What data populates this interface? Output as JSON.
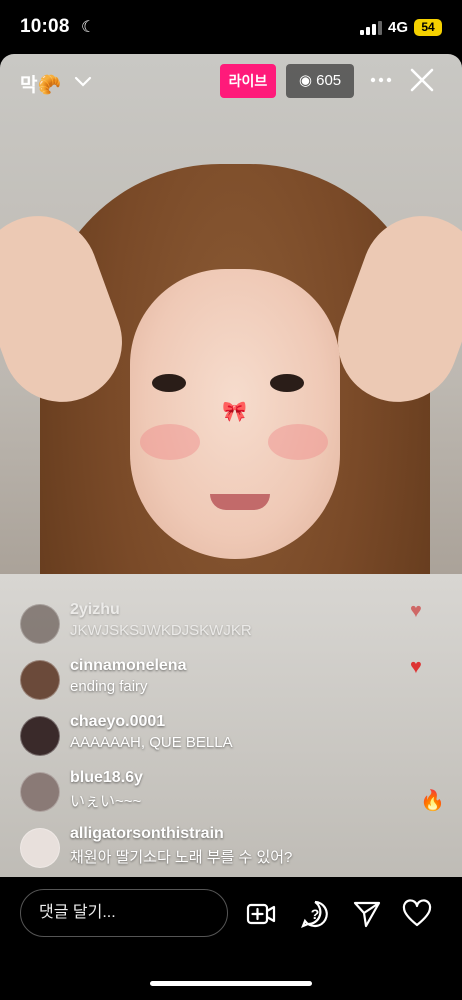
{
  "status_bar": {
    "time": "10:08",
    "network": "4G",
    "battery": "54"
  },
  "header": {
    "username": "막🥐",
    "live_label": "라이브",
    "viewer_count": "605"
  },
  "comments": [
    {
      "user": "2yizhu",
      "text": "JKWJSKSJWKDJSKWJKR"
    },
    {
      "user": "cinnamonelena",
      "text": "ending fairy"
    },
    {
      "user": "chaeyo.0001",
      "text": "AAAAAAH, QUE BELLA"
    },
    {
      "user": "blue18.6y",
      "text": "いぇい~~~"
    },
    {
      "user": "alligatorsonthistrain",
      "text": "채원아 딸기소다 노래 부를 수 있어?"
    }
  ],
  "bottom_bar": {
    "comment_placeholder": "댓글 달기..."
  },
  "colors": {
    "live": "#ff1a7a",
    "battery": "#f5d100"
  }
}
